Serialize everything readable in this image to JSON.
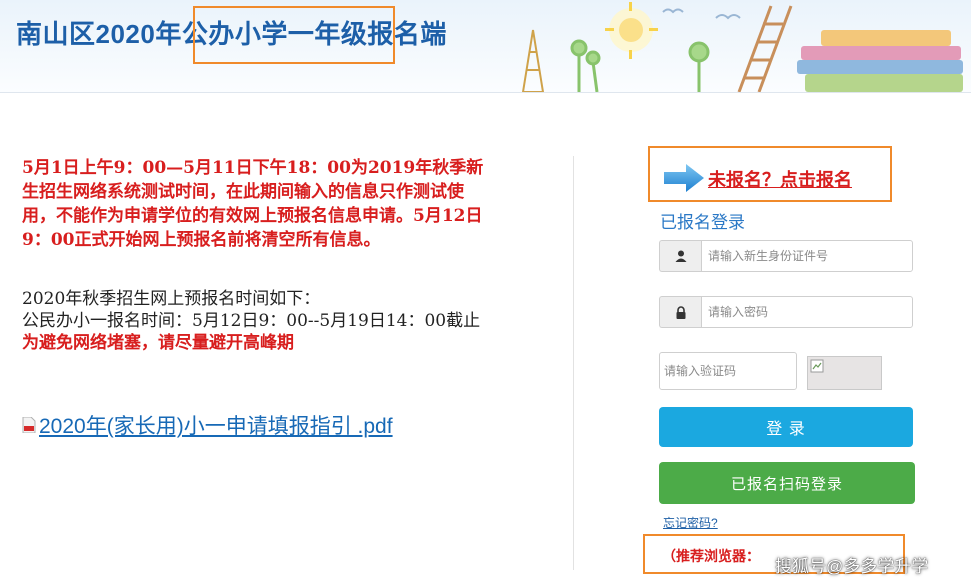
{
  "header": {
    "title": "南山区2020年公办小学一年级报名端"
  },
  "notice": {
    "text": "5月1日上午9：00—5月11日下午18：00为2019年秋季新生招生网络系统测试时间，在此期间输入的信息只作测试使用，不能作为申请学位的有效网上预报名信息申请。5月12日9：00正式开始网上预报名前将清空所有信息。"
  },
  "schedule": {
    "heading": "2020年秋季招生网上预报名时间如下：",
    "line": "公民办小一报名时间：5月12日9：00--5月19日14：00截止",
    "warning": "为避免网络堵塞，请尽量避开高峰期"
  },
  "pdf_link": {
    "label": "2020年(家长用)小一申请填报指引 .pdf"
  },
  "login": {
    "register_link": "未报名？点击报名",
    "heading": "已报名登录",
    "id_placeholder": "请输入新生身份证件号",
    "password_placeholder": "请输入密码",
    "captcha_placeholder": "请输入验证码",
    "login_button": "登 录",
    "scan_button": "已报名扫码登录",
    "forgot_link": "忘记密码?",
    "browser_label": "（推荐浏览器：",
    "watermark": "搜狐号@多多学升学"
  },
  "colors": {
    "title_blue": "#1d5fa8",
    "alert_red": "#d81e1e",
    "login_blue": "#1ba8e0",
    "scan_green": "#4cab48",
    "highlight_orange": "#f08a2b"
  }
}
